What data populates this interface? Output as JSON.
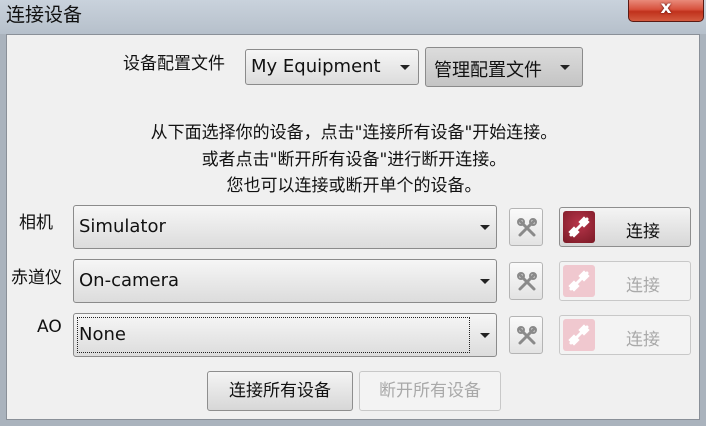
{
  "window": {
    "title": "连接设备",
    "close_glyph": "x"
  },
  "profile": {
    "label": "设备配置文件",
    "selected": "My Equipment",
    "manage_label": "管理配置文件"
  },
  "instructions": {
    "line1": "从下面选择你的设备，点击\"连接所有设备\"开始连接。",
    "line2": "或者点击\"断开所有设备\"进行断开连接。",
    "line3": "您也可以连接或断开单个的设备。"
  },
  "devices": [
    {
      "label": "相机",
      "selected": "Simulator",
      "connect_label": "连接",
      "connect_enabled": true
    },
    {
      "label": "赤道仪",
      "selected": "On-camera",
      "connect_label": "连接",
      "connect_enabled": false
    },
    {
      "label": "AO",
      "selected": "None",
      "connect_label": "连接",
      "connect_enabled": false
    }
  ],
  "footer": {
    "connect_all_label": "连接所有设备",
    "disconnect_all_label": "断开所有设备"
  },
  "icons": {
    "close": "close-icon",
    "dropdown": "chevron-down-icon",
    "settings": "tools-icon",
    "connect": "plug-icon"
  },
  "colors": {
    "plug_active": "#8b1f2e",
    "plug_inactive": "#f0c8cf",
    "close_button": "#c7402b"
  }
}
